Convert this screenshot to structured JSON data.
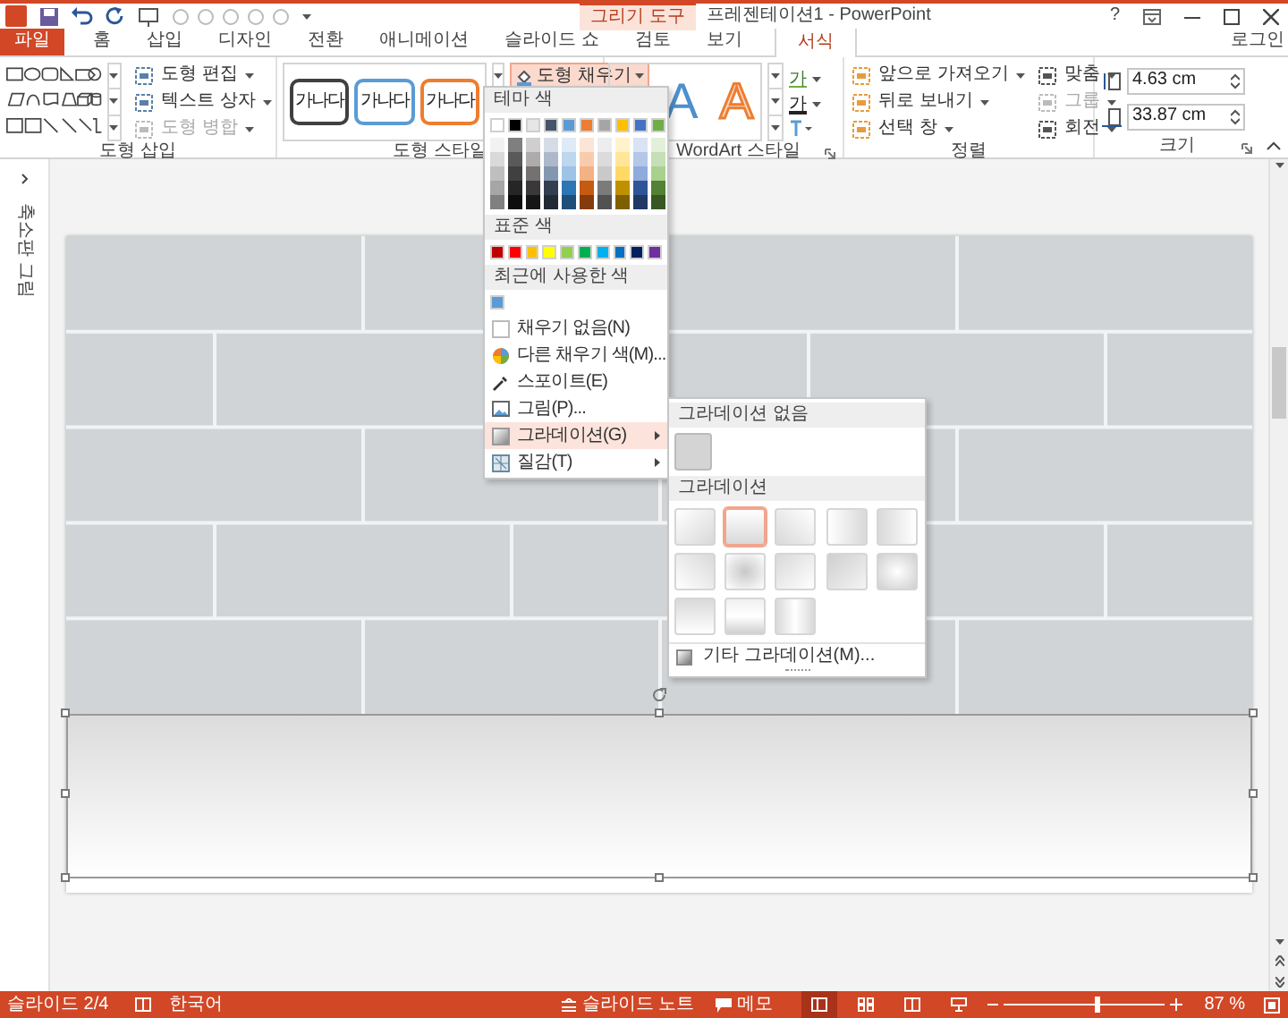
{
  "title_bar": {
    "context_label": "그리기 도구",
    "title": "프레젠테이션1 - PowerPoint",
    "help": "?"
  },
  "tabs": [
    {
      "label": "파일",
      "kind": "file",
      "selected": false
    },
    {
      "label": "홈",
      "kind": "normal",
      "selected": false
    },
    {
      "label": "삽입",
      "kind": "normal",
      "selected": false
    },
    {
      "label": "디자인",
      "kind": "normal",
      "selected": false
    },
    {
      "label": "전환",
      "kind": "normal",
      "selected": false
    },
    {
      "label": "애니메이션",
      "kind": "normal",
      "selected": false
    },
    {
      "label": "슬라이드 쇼",
      "kind": "normal",
      "selected": false
    },
    {
      "label": "검토",
      "kind": "normal",
      "selected": false
    },
    {
      "label": "보기",
      "kind": "normal",
      "selected": false
    },
    {
      "label": "서식",
      "kind": "context",
      "selected": true
    }
  ],
  "sign_in": "로그인",
  "ribbon": {
    "insert_shapes": {
      "label": "도형 삽입",
      "commands": [
        {
          "label": "도형 편집",
          "disabled": false
        },
        {
          "label": "텍스트 상자",
          "disabled": false
        },
        {
          "label": "도형 병합",
          "disabled": true
        }
      ]
    },
    "shape_styles": {
      "label": "도형 스타일",
      "samples": [
        {
          "text": "가나다",
          "color": "#404040"
        },
        {
          "text": "가나다",
          "color": "#5b9bd5"
        },
        {
          "text": "가나다",
          "color": "#ed7d31"
        }
      ],
      "fill_button": {
        "label": "도형 채우기",
        "open": true
      }
    },
    "wordart": {
      "label": "WordArt 스타일",
      "samples": [
        {
          "text": "A",
          "kind": "fill"
        },
        {
          "text": "A",
          "kind": "outline"
        }
      ],
      "text_buttons": [
        {
          "text": "가",
          "kind": "fill"
        },
        {
          "text": "가",
          "kind": "outline"
        }
      ]
    },
    "arrange": {
      "label": "정렬",
      "commands": [
        {
          "label": "앞으로 가져오기",
          "disabled": false
        },
        {
          "label": "뒤로 보내기",
          "disabled": false
        },
        {
          "label": "선택 창",
          "disabled": false
        },
        {
          "label": "맞춤",
          "disabled": false
        },
        {
          "label": "그룹",
          "disabled": true
        },
        {
          "label": "회전",
          "disabled": false
        }
      ]
    },
    "size": {
      "label": "크기",
      "height": "4.63 cm",
      "width": "33.87 cm"
    }
  },
  "thumbnail_pane": {
    "label": "축소판 그림"
  },
  "fill_menu": {
    "theme_heading": "테마 색",
    "theme_colors": [
      {
        "color": "#ffffff",
        "shades": [
          {
            "color": "#f2f2f2"
          },
          {
            "color": "#d9d9d9"
          },
          {
            "color": "#bfbfbf"
          },
          {
            "color": "#a6a6a6"
          },
          {
            "color": "#808080"
          }
        ]
      },
      {
        "color": "#000000",
        "shades": [
          {
            "color": "#7f7f7f"
          },
          {
            "color": "#595959"
          },
          {
            "color": "#404040"
          },
          {
            "color": "#262626"
          },
          {
            "color": "#0d0d0d"
          }
        ]
      },
      {
        "color": "#e7e6e6",
        "shades": [
          {
            "color": "#d0cece"
          },
          {
            "color": "#aeabab"
          },
          {
            "color": "#757171"
          },
          {
            "color": "#3a3838"
          },
          {
            "color": "#171616"
          }
        ]
      },
      {
        "color": "#44546a",
        "shades": [
          {
            "color": "#d6dce5"
          },
          {
            "color": "#adb9ca"
          },
          {
            "color": "#8497b0"
          },
          {
            "color": "#333f50"
          },
          {
            "color": "#222a35"
          }
        ]
      },
      {
        "color": "#5b9bd5",
        "shades": [
          {
            "color": "#deebf7"
          },
          {
            "color": "#bdd7ee"
          },
          {
            "color": "#9dc3e6"
          },
          {
            "color": "#2e75b6"
          },
          {
            "color": "#1f4e79"
          }
        ]
      },
      {
        "color": "#ed7d31",
        "shades": [
          {
            "color": "#fbe5d6"
          },
          {
            "color": "#f8cbad"
          },
          {
            "color": "#f4b183"
          },
          {
            "color": "#c55a11"
          },
          {
            "color": "#843c0c"
          }
        ]
      },
      {
        "color": "#a5a5a5",
        "shades": [
          {
            "color": "#ededed"
          },
          {
            "color": "#dbdbdb"
          },
          {
            "color": "#c9c9c9"
          },
          {
            "color": "#7b7b7b"
          },
          {
            "color": "#525252"
          }
        ]
      },
      {
        "color": "#ffc000",
        "shades": [
          {
            "color": "#fff2cc"
          },
          {
            "color": "#ffe699"
          },
          {
            "color": "#ffd966"
          },
          {
            "color": "#bf9000"
          },
          {
            "color": "#7f6000"
          }
        ]
      },
      {
        "color": "#4472c4",
        "shades": [
          {
            "color": "#dae3f3"
          },
          {
            "color": "#b4c7e7"
          },
          {
            "color": "#8faadc"
          },
          {
            "color": "#2f5597"
          },
          {
            "color": "#203864"
          }
        ]
      },
      {
        "color": "#70ad47",
        "shades": [
          {
            "color": "#e2f0d9"
          },
          {
            "color": "#c5e0b4"
          },
          {
            "color": "#a9d18e"
          },
          {
            "color": "#538135"
          },
          {
            "color": "#385723"
          }
        ]
      }
    ],
    "standard_heading": "표준 색",
    "standard_colors": [
      {
        "color": "#c00000"
      },
      {
        "color": "#ff0000"
      },
      {
        "color": "#ffc000"
      },
      {
        "color": "#ffff00"
      },
      {
        "color": "#92d050"
      },
      {
        "color": "#00b050"
      },
      {
        "color": "#00b0f0"
      },
      {
        "color": "#0070c0"
      },
      {
        "color": "#002060"
      },
      {
        "color": "#7030a0"
      }
    ],
    "recent_heading": "최근에 사용한 색",
    "recent_colors": [
      {
        "color": "#5b9bd5"
      }
    ],
    "items": [
      {
        "label": "채우기 없음(N)",
        "kind": "none",
        "submenu": false,
        "selected": false
      },
      {
        "label": "다른 채우기 색(M)...",
        "kind": "more",
        "submenu": false,
        "selected": false
      },
      {
        "label": "스포이트(E)",
        "kind": "eyedropper",
        "submenu": false,
        "selected": false
      },
      {
        "label": "그림(P)...",
        "kind": "picture",
        "submenu": false,
        "selected": false
      },
      {
        "label": "그라데이션(G)",
        "kind": "gradient",
        "submenu": true,
        "selected": true
      },
      {
        "label": "질감(T)",
        "kind": "texture",
        "submenu": true,
        "selected": false
      }
    ]
  },
  "gradient_menu": {
    "none_heading": "그라데이션 없음",
    "gradient_heading": "그라데이션",
    "swatches": [
      {
        "kind": "br",
        "selected": false
      },
      {
        "kind": "b",
        "selected": true
      },
      {
        "kind": "bl",
        "selected": false
      },
      {
        "kind": "r",
        "selected": false
      },
      {
        "kind": "l",
        "selected": false
      },
      {
        "kind": "tr",
        "selected": false
      },
      {
        "kind": "radial",
        "selected": false
      },
      {
        "kind": "tl",
        "selected": false
      },
      {
        "kind": "rl",
        "selected": false
      },
      {
        "kind": "ring",
        "selected": false
      },
      {
        "kind": "t",
        "selected": false
      },
      {
        "kind": "tb",
        "selected": false
      },
      {
        "kind": "lr",
        "selected": false
      }
    ],
    "more": "기타 그라데이션(M)..."
  },
  "status_bar": {
    "slide": "슬라이드 2/4",
    "language": "한국어",
    "notes": "슬라이드 노트",
    "comments": "메모",
    "views": [
      {
        "kind": "normal",
        "selected": true
      },
      {
        "kind": "sorter",
        "selected": false
      },
      {
        "kind": "reading",
        "selected": false
      },
      {
        "kind": "show",
        "selected": false
      }
    ],
    "zoom": {
      "level": 0.58,
      "reading": "87 %"
    }
  }
}
